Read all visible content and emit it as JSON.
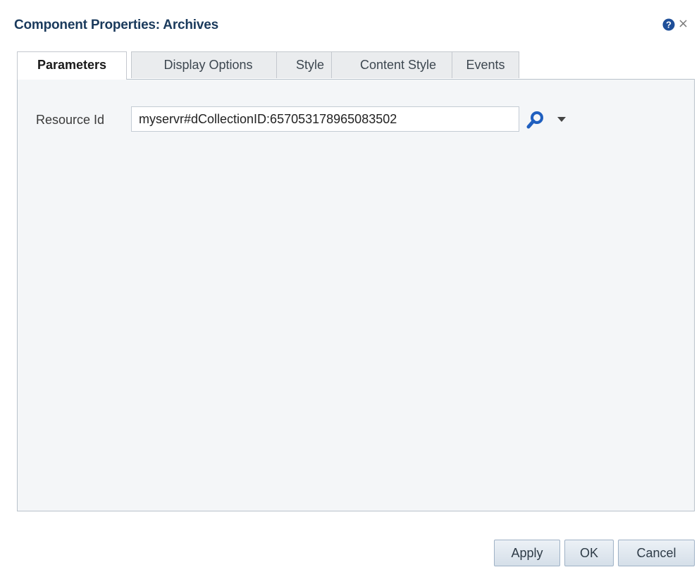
{
  "dialog": {
    "title": "Component Properties: Archives",
    "help_icon": "help-icon",
    "close_icon": "close-icon",
    "close_glyph": "×"
  },
  "tabs": [
    {
      "label": "Parameters",
      "active": true
    },
    {
      "label": "Display Options",
      "active": false
    },
    {
      "label": "Style",
      "active": false
    },
    {
      "label": "Content Style",
      "active": false
    },
    {
      "label": "Events",
      "active": false
    }
  ],
  "parameters": {
    "resource_id_label": "Resource Id",
    "resource_id_value": "myservr#dCollectionID:657053178965083502",
    "search_icon": "search-icon",
    "dropdown_icon": "chevron-down-icon"
  },
  "buttons": {
    "apply": "Apply",
    "ok": "OK",
    "cancel": "Cancel"
  },
  "colors": {
    "title": "#1a3a5c",
    "accent_blue": "#1f5fbf",
    "panel_bg": "#f4f6f8"
  }
}
